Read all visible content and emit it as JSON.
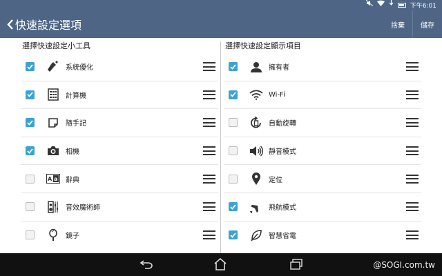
{
  "status_bar": {
    "time": "下午6:01",
    "icons": [
      "mute-icon",
      "wifi-icon",
      "download-icon",
      "battery-icon"
    ]
  },
  "action_bar": {
    "title": "快速設定選項",
    "discard_label": "捨棄",
    "save_label": "儲存"
  },
  "left_panel": {
    "title": "選擇快速設定小工具",
    "items": [
      {
        "label": "系統優化",
        "checked": true,
        "icon": "broom-icon"
      },
      {
        "label": "計算機",
        "checked": true,
        "icon": "calculator-icon"
      },
      {
        "label": "隨手記",
        "checked": true,
        "icon": "note-icon"
      },
      {
        "label": "相機",
        "checked": true,
        "icon": "camera-icon"
      },
      {
        "label": "辭典",
        "checked": false,
        "icon": "dictionary-icon"
      },
      {
        "label": "音效魔術師",
        "checked": false,
        "icon": "equalizer-icon"
      },
      {
        "label": "鏡子",
        "checked": false,
        "icon": "mirror-icon"
      }
    ]
  },
  "right_panel": {
    "title": "選擇快速設定顯示項目",
    "items": [
      {
        "label": "擁有者",
        "checked": true,
        "icon": "person-icon"
      },
      {
        "label": "Wi-Fi",
        "checked": true,
        "icon": "wifi-icon"
      },
      {
        "label": "自動旋轉",
        "checked": false,
        "icon": "rotate-icon"
      },
      {
        "label": "靜音模式",
        "checked": false,
        "icon": "speaker-icon"
      },
      {
        "label": "定位",
        "checked": false,
        "icon": "location-icon"
      },
      {
        "label": "飛航模式",
        "checked": true,
        "icon": "airplane-icon"
      },
      {
        "label": "智慧省電",
        "checked": true,
        "icon": "leaf-icon"
      }
    ]
  },
  "nav_bar": {
    "buttons": [
      "back-icon",
      "home-icon",
      "recent-apps-icon"
    ]
  },
  "watermark": "@SOGI.com.tw"
}
